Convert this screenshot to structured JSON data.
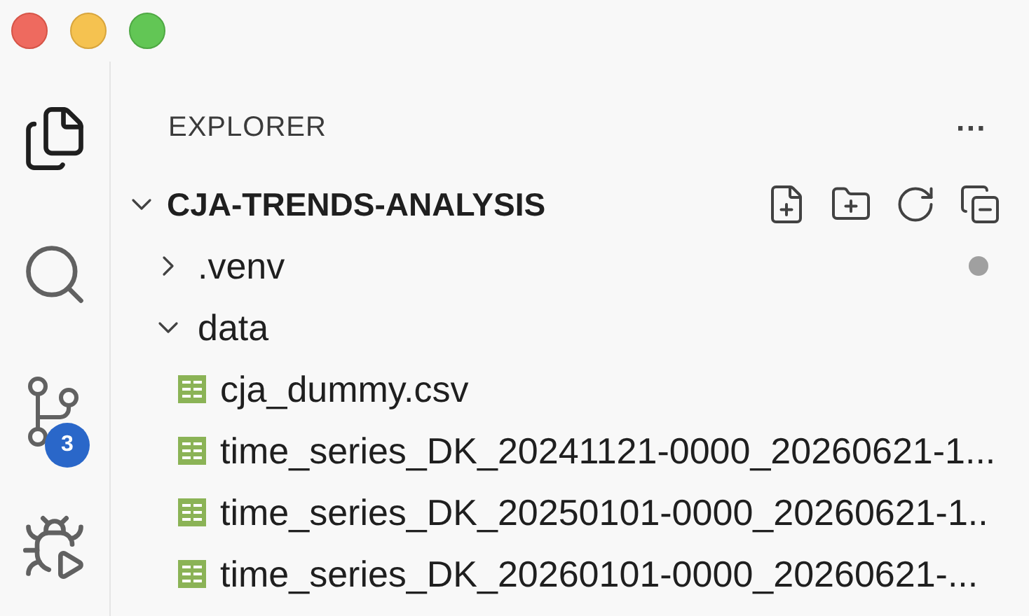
{
  "activity_bar": [
    {
      "kind": "explorer",
      "selected": true
    },
    {
      "kind": "search",
      "selected": false
    },
    {
      "kind": "source_control",
      "selected": false,
      "badge": "3"
    },
    {
      "kind": "run_debug",
      "selected": false
    }
  ],
  "sidebar": {
    "title": "EXPLORER",
    "more": "···",
    "project": {
      "name": "CJA-TRENDS-ANALYSIS",
      "expanded": true
    },
    "tree": [
      {
        "kind": "folder",
        "name": ".venv",
        "expanded": false,
        "modified_dot": true
      },
      {
        "kind": "folder",
        "name": "data",
        "expanded": true,
        "modified_dot": false,
        "children": [
          {
            "kind": "csv",
            "name": "cja_dummy.csv"
          },
          {
            "kind": "csv",
            "name": "time_series_DK_20241121-0000_20260621-1..."
          },
          {
            "kind": "csv",
            "name": "time_series_DK_20250101-0000_20260621-1.."
          },
          {
            "kind": "csv",
            "name": "time_series_DK_20260101-0000_20260621-..."
          }
        ]
      }
    ]
  }
}
